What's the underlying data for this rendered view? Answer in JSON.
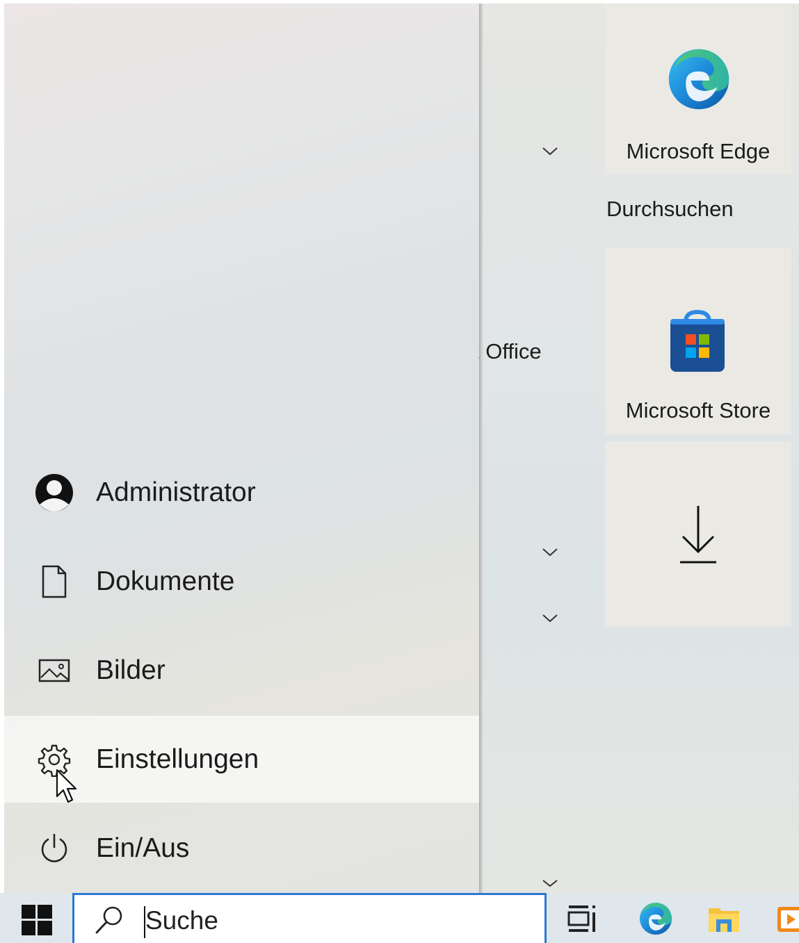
{
  "start_menu": {
    "nav_items": [
      {
        "label": "Administrator",
        "icon": "user-avatar-icon"
      },
      {
        "label": "Dokumente",
        "icon": "document-icon"
      },
      {
        "label": "Bilder",
        "icon": "pictures-icon"
      },
      {
        "label": "Einstellungen",
        "icon": "gear-icon",
        "hovered": true
      },
      {
        "label": "Ein/Aus",
        "icon": "power-icon"
      }
    ],
    "app_list_partial_label": "t Office",
    "tiles": {
      "edge": {
        "label": "Microsoft Edge",
        "icon": "edge-icon"
      },
      "group_label": "Durchsuchen",
      "store": {
        "label": "Microsoft Store",
        "icon": "store-icon"
      },
      "download": {
        "icon": "download-arrow-icon"
      }
    }
  },
  "taskbar": {
    "search": {
      "placeholder": "Suche",
      "icon": "search-icon"
    },
    "icons": [
      "windows-start-icon",
      "task-view-icon",
      "edge-icon",
      "file-explorer-icon",
      "media-player-icon"
    ]
  },
  "colors": {
    "accent": "#2b78d4",
    "taskbar": "#dfe6ec",
    "tile_bg": "#eae9e4"
  }
}
